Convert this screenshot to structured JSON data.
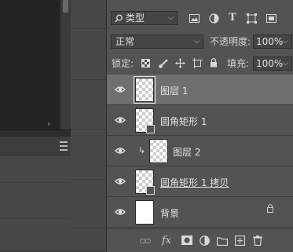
{
  "layers_panel": {
    "filter": {
      "kind_label": "类型",
      "search_icon": "search-icon"
    },
    "filter_icons": [
      "image-filter-icon",
      "adjustment-filter-icon",
      "text-filter-icon",
      "shape-filter-icon",
      "smart-object-filter-icon"
    ],
    "blend_mode": "正常",
    "opacity_label": "不透明度:",
    "opacity_value": "100%",
    "lock_label": "锁定:",
    "lock_icons": [
      "lock-transparent-icon",
      "lock-paint-icon",
      "lock-move-icon",
      "lock-artboard-icon",
      "lock-all-icon"
    ],
    "fill_label": "填充:",
    "fill_value": "100%",
    "layers": [
      {
        "name": "图层 1",
        "type": "pixel",
        "visible": true,
        "selected": true
      },
      {
        "name": "圆角矩形 1",
        "type": "shape",
        "visible": true,
        "selected": false
      },
      {
        "name": "图层 2",
        "type": "pixel",
        "visible": true,
        "clipped": true,
        "selected": false
      },
      {
        "name": "圆角矩形 1 拷贝",
        "type": "shape",
        "visible": true,
        "selected": false
      },
      {
        "name": "背景",
        "type": "background",
        "visible": true,
        "locked": true,
        "selected": false
      }
    ],
    "footer_icons": [
      "link-icon",
      "fx-icon",
      "mask-icon",
      "adjustment-icon",
      "folder-icon",
      "new-layer-icon",
      "trash-icon"
    ],
    "fx_label": "fx"
  },
  "colors": {
    "panel_bg": "#535353",
    "selected_row": "#6f6f6f",
    "canvas_bg": "#232323"
  }
}
